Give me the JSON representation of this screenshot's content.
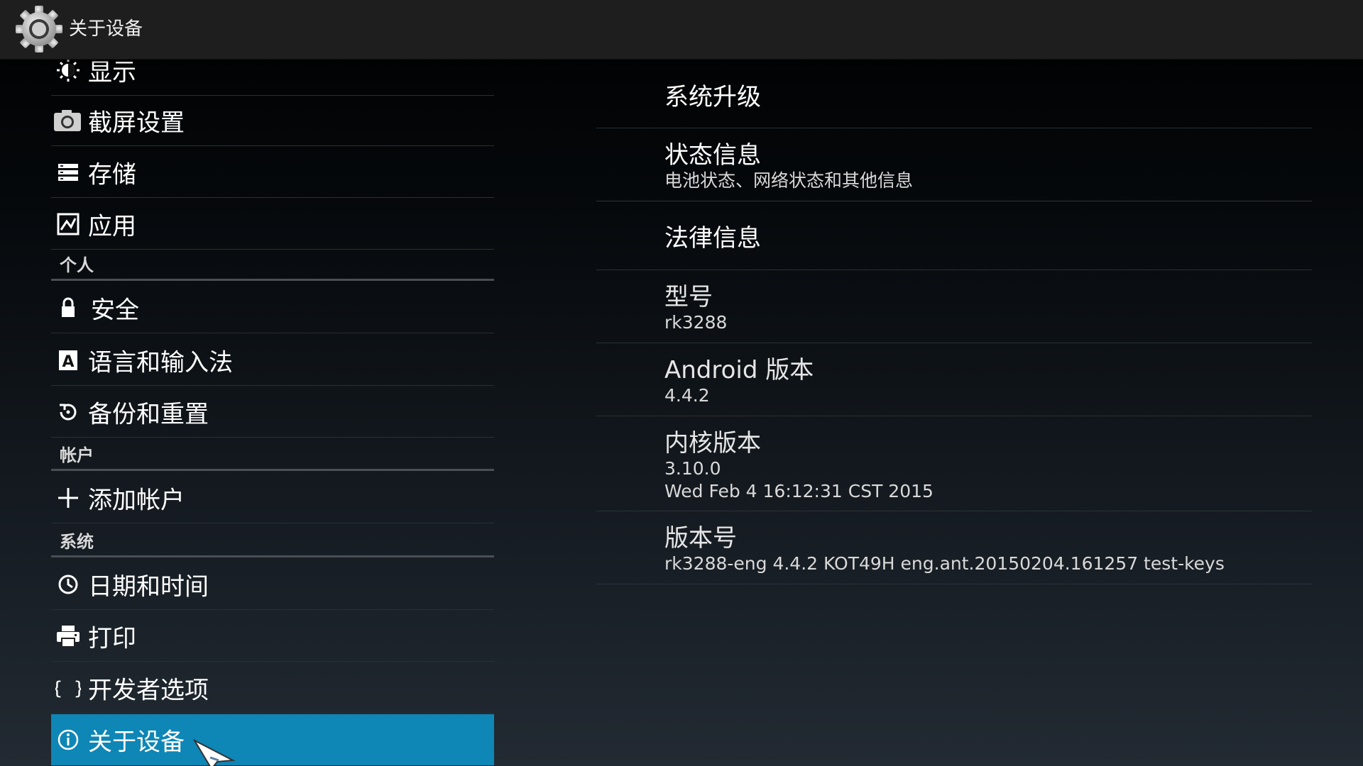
{
  "action_bar": {
    "title": "关于设备",
    "icon": "gear-icon"
  },
  "sidebar": {
    "items": [
      {
        "label": "显示",
        "icon": "brightness-icon"
      },
      {
        "label": "截屏设置",
        "icon": "camera-icon"
      },
      {
        "label": "存储",
        "icon": "storage-icon"
      },
      {
        "label": "应用",
        "icon": "apps-icon"
      }
    ],
    "section_personal": "个人",
    "personal_items": [
      {
        "label": "安全",
        "icon": "lock-icon"
      },
      {
        "label": "语言和输入法",
        "icon": "language-icon"
      },
      {
        "label": "备份和重置",
        "icon": "backup-icon"
      }
    ],
    "section_accounts": "帐户",
    "account_items": [
      {
        "label": "添加帐户",
        "icon": "plus-icon"
      }
    ],
    "section_system": "系统",
    "system_items": [
      {
        "label": "日期和时间",
        "icon": "clock-icon"
      },
      {
        "label": "打印",
        "icon": "printer-icon"
      },
      {
        "label": "开发者选项",
        "icon": "braces-icon"
      },
      {
        "label": "关于设备",
        "icon": "info-icon",
        "selected": true
      }
    ]
  },
  "about": {
    "system_update": {
      "title": "系统升级"
    },
    "status": {
      "title": "状态信息",
      "summary": "电池状态、网络状态和其他信息"
    },
    "legal": {
      "title": "法律信息"
    },
    "model": {
      "title": "型号",
      "value": "rk3288"
    },
    "android_version": {
      "title": "Android 版本",
      "value": "4.4.2"
    },
    "kernel_version": {
      "title": "内核版本",
      "value_line1": "3.10.0",
      "value_line2": "Wed Feb 4 16:12:31 CST 2015"
    },
    "build_number": {
      "title": "版本号",
      "value": "rk3288-eng 4.4.2 KOT49H eng.ant.20150204.161257 test-keys"
    }
  },
  "colors": {
    "accent": "#0e86b6",
    "action_bar": "#1e1e1e",
    "divider": "#2c3034"
  }
}
